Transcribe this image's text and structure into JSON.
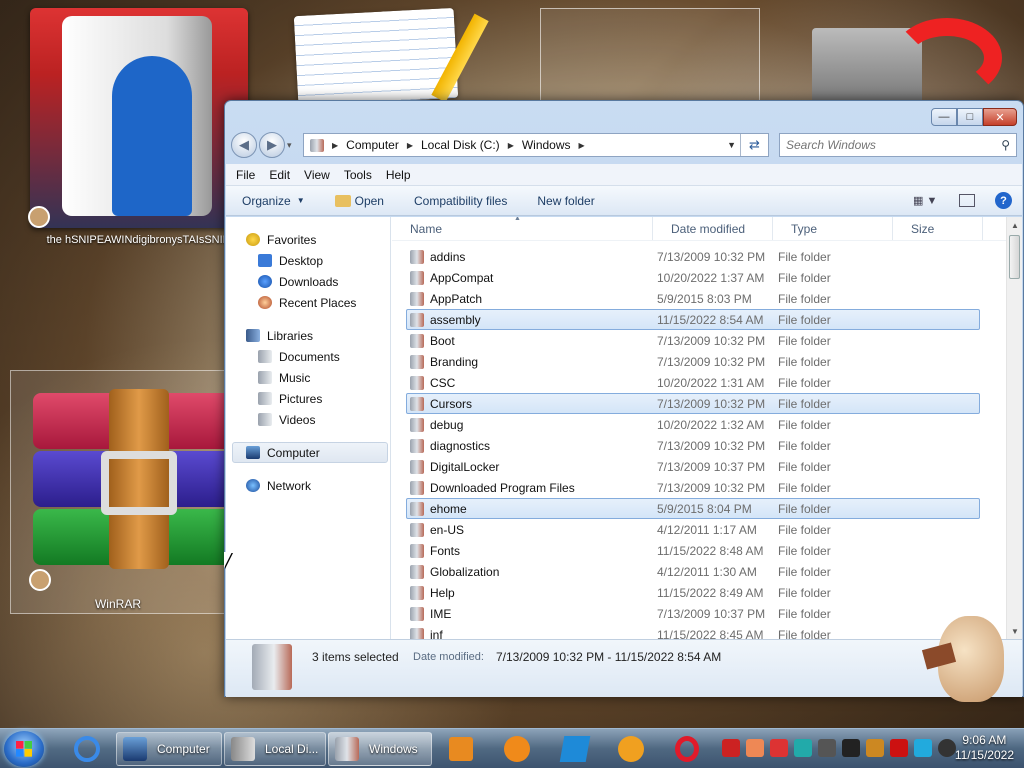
{
  "desktop": {
    "icons": [
      {
        "label": "the hSNIPEAWINdigibronysTAIsSNIPE"
      },
      {
        "label": "WinRAR"
      }
    ]
  },
  "window": {
    "nav": {
      "back": "◀",
      "forward": "▶",
      "history": "▾"
    },
    "address": {
      "crumbs": [
        "Computer",
        "Local Disk (C:)",
        "Windows"
      ]
    },
    "search": {
      "placeholder": "Search Windows"
    },
    "menu": [
      "File",
      "Edit",
      "View",
      "Tools",
      "Help"
    ],
    "commands": {
      "organize": "Organize",
      "open": "Open",
      "compat": "Compatibility files",
      "new_folder": "New folder"
    },
    "navpane": {
      "favorites": {
        "label": "Favorites",
        "items": [
          "Desktop",
          "Downloads",
          "Recent Places"
        ]
      },
      "libraries": {
        "label": "Libraries",
        "items": [
          "Documents",
          "Music",
          "Pictures",
          "Videos"
        ]
      },
      "computer": "Computer",
      "network": "Network"
    },
    "columns": {
      "name": "Name",
      "date": "Date modified",
      "type": "Type",
      "size": "Size"
    },
    "files": [
      {
        "name": "addins",
        "date": "7/13/2009 10:32 PM",
        "type": "File folder",
        "selected": false
      },
      {
        "name": "AppCompat",
        "date": "10/20/2022 1:37 AM",
        "type": "File folder",
        "selected": false
      },
      {
        "name": "AppPatch",
        "date": "5/9/2015 8:03 PM",
        "type": "File folder",
        "selected": false
      },
      {
        "name": "assembly",
        "date": "11/15/2022 8:54 AM",
        "type": "File folder",
        "selected": true
      },
      {
        "name": "Boot",
        "date": "7/13/2009 10:32 PM",
        "type": "File folder",
        "selected": false
      },
      {
        "name": "Branding",
        "date": "7/13/2009 10:32 PM",
        "type": "File folder",
        "selected": false
      },
      {
        "name": "CSC",
        "date": "10/20/2022 1:31 AM",
        "type": "File folder",
        "selected": false
      },
      {
        "name": "Cursors",
        "date": "7/13/2009 10:32 PM",
        "type": "File folder",
        "selected": true
      },
      {
        "name": "debug",
        "date": "10/20/2022 1:32 AM",
        "type": "File folder",
        "selected": false
      },
      {
        "name": "diagnostics",
        "date": "7/13/2009 10:32 PM",
        "type": "File folder",
        "selected": false
      },
      {
        "name": "DigitalLocker",
        "date": "7/13/2009 10:37 PM",
        "type": "File folder",
        "selected": false
      },
      {
        "name": "Downloaded Program Files",
        "date": "7/13/2009 10:32 PM",
        "type": "File folder",
        "selected": false
      },
      {
        "name": "ehome",
        "date": "5/9/2015 8:04 PM",
        "type": "File folder",
        "selected": true
      },
      {
        "name": "en-US",
        "date": "4/12/2011 1:17 AM",
        "type": "File folder",
        "selected": false
      },
      {
        "name": "Fonts",
        "date": "11/15/2022 8:48 AM",
        "type": "File folder",
        "selected": false
      },
      {
        "name": "Globalization",
        "date": "4/12/2011 1:30 AM",
        "type": "File folder",
        "selected": false
      },
      {
        "name": "Help",
        "date": "11/15/2022 8:49 AM",
        "type": "File folder",
        "selected": false
      },
      {
        "name": "IME",
        "date": "7/13/2009 10:37 PM",
        "type": "File folder",
        "selected": false
      },
      {
        "name": "inf",
        "date": "11/15/2022 8:45 AM",
        "type": "File folder",
        "selected": false
      }
    ],
    "details": {
      "selection": "3 items selected",
      "date_label": "Date modified:",
      "date_value": "7/13/2009 10:32 PM - 11/15/2022 8:54 AM"
    }
  },
  "taskbar": {
    "tasks": [
      {
        "label": "Computer"
      },
      {
        "label": "Local Di..."
      },
      {
        "label": "Windows"
      }
    ],
    "clock": {
      "time": "9:06 AM",
      "date": "11/15/2022"
    }
  },
  "colors": {
    "selection_border": "#84acdd",
    "selection_fill": "#d4e5f8",
    "accent": "#1e3e66"
  }
}
